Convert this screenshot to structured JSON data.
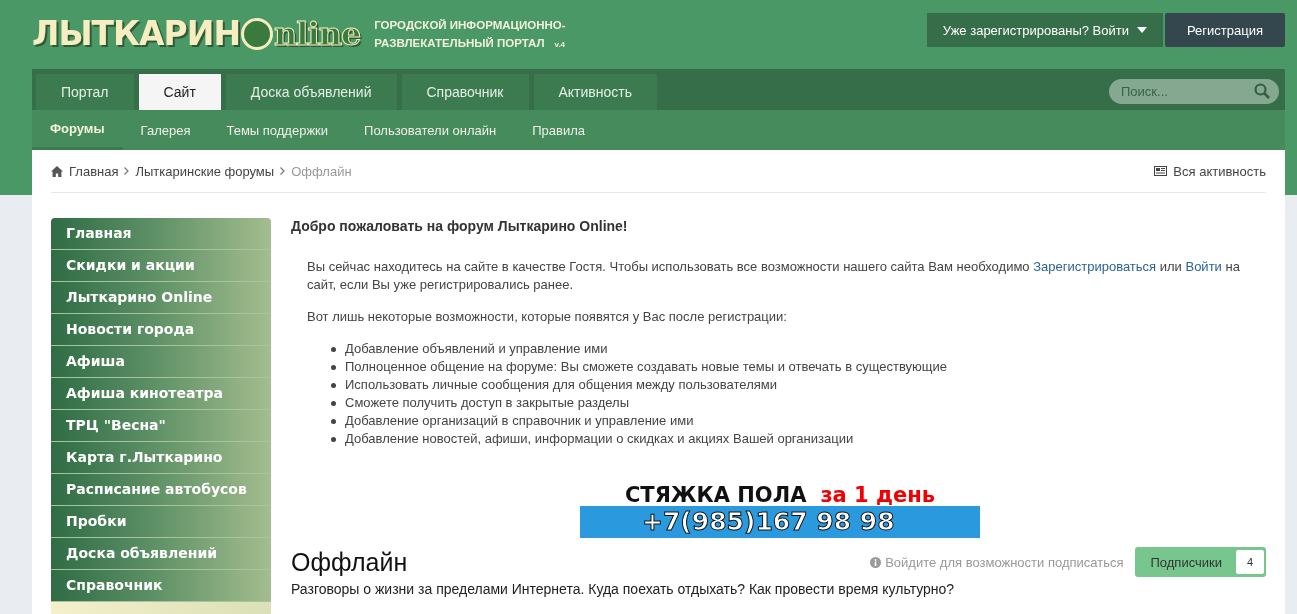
{
  "logo": {
    "main": "ЛЫТКАРИН",
    "suffix": "nline",
    "tagline_1": "ГОРОДСКОЙ ИНФОРМАЦИОННО-",
    "tagline_2": "РАЗВЛЕКАТЕЛЬНЫЙ ПОРТАЛ",
    "version": "v.4"
  },
  "user_bar": {
    "login": "Уже зарегистрированы? Войти",
    "register": "Регистрация"
  },
  "tabs": [
    {
      "label": "Портал",
      "selected": false
    },
    {
      "label": "Сайт",
      "selected": true
    },
    {
      "label": "Доска объявлений",
      "selected": false
    },
    {
      "label": "Справочник",
      "selected": false
    },
    {
      "label": "Активность",
      "selected": false
    }
  ],
  "search": {
    "placeholder": "Поиск..."
  },
  "subnav": [
    {
      "label": "Форумы",
      "selected": true
    },
    {
      "label": "Галерея",
      "selected": false
    },
    {
      "label": "Темы поддержки",
      "selected": false
    },
    {
      "label": "Пользователи онлайн",
      "selected": false
    },
    {
      "label": "Правила",
      "selected": false
    }
  ],
  "breadcrumb": [
    "Главная",
    "Лыткаринские форумы",
    "Оффлайн"
  ],
  "all_activity": "Вся активность",
  "sidebar": {
    "items": [
      "Главная",
      "Скидки и акции",
      "Лыткарино Online",
      "Новости города",
      "Афиша",
      "Афиша кинотеатра",
      "ТРЦ \"Весна\"",
      "Карта г.Лыткарино",
      "Расписание автобусов",
      "Пробки",
      "Доска объявлений",
      "Справочник"
    ]
  },
  "welcome": {
    "title": "Добро пожаловать на форум Лыткарино Online!",
    "intro": [
      {
        "text": "Вы сейчас находитесь на сайте в качестве Гостя. Чтобы использовать все возможности нашего сайта Вам необходимо ",
        "link": false
      },
      {
        "text": "Зарегистрироваться",
        "link": true
      },
      {
        "text": " или ",
        "link": false
      },
      {
        "text": "Войти",
        "link": true
      },
      {
        "text": " на сайт, если Вы уже регистрировались ранее.",
        "link": false
      }
    ],
    "lead": "Вот лишь некоторые возможности, которые появятся у Вас после регистрации:",
    "features": [
      "Добавление объявлений и управление ими",
      "Полноценное общение на форуме: Вы сможете создавать новые темы и отвечать в существующие",
      "Использовать личные сообщения для общения между пользователями",
      "Сможете получить доступ в закрытые разделы",
      "Добавление организаций в справочник и управление ими",
      "Добавление новостей, афиши, информации о скидках и акциях Вашей организации"
    ]
  },
  "banner": {
    "headline": "СТЯЖКА ПОЛА",
    "accent": "за 1 день",
    "phone": "+7(985)167 98 98"
  },
  "forum": {
    "title": "Оффлайн",
    "subscribe_hint": "Войдите для возможности подписаться",
    "followers_label": "Подписчики",
    "followers_count": "4",
    "description": "Разговоры о жизни за пределами Интернета. Куда поехать отдыхать? Как провести время культурно?"
  }
}
